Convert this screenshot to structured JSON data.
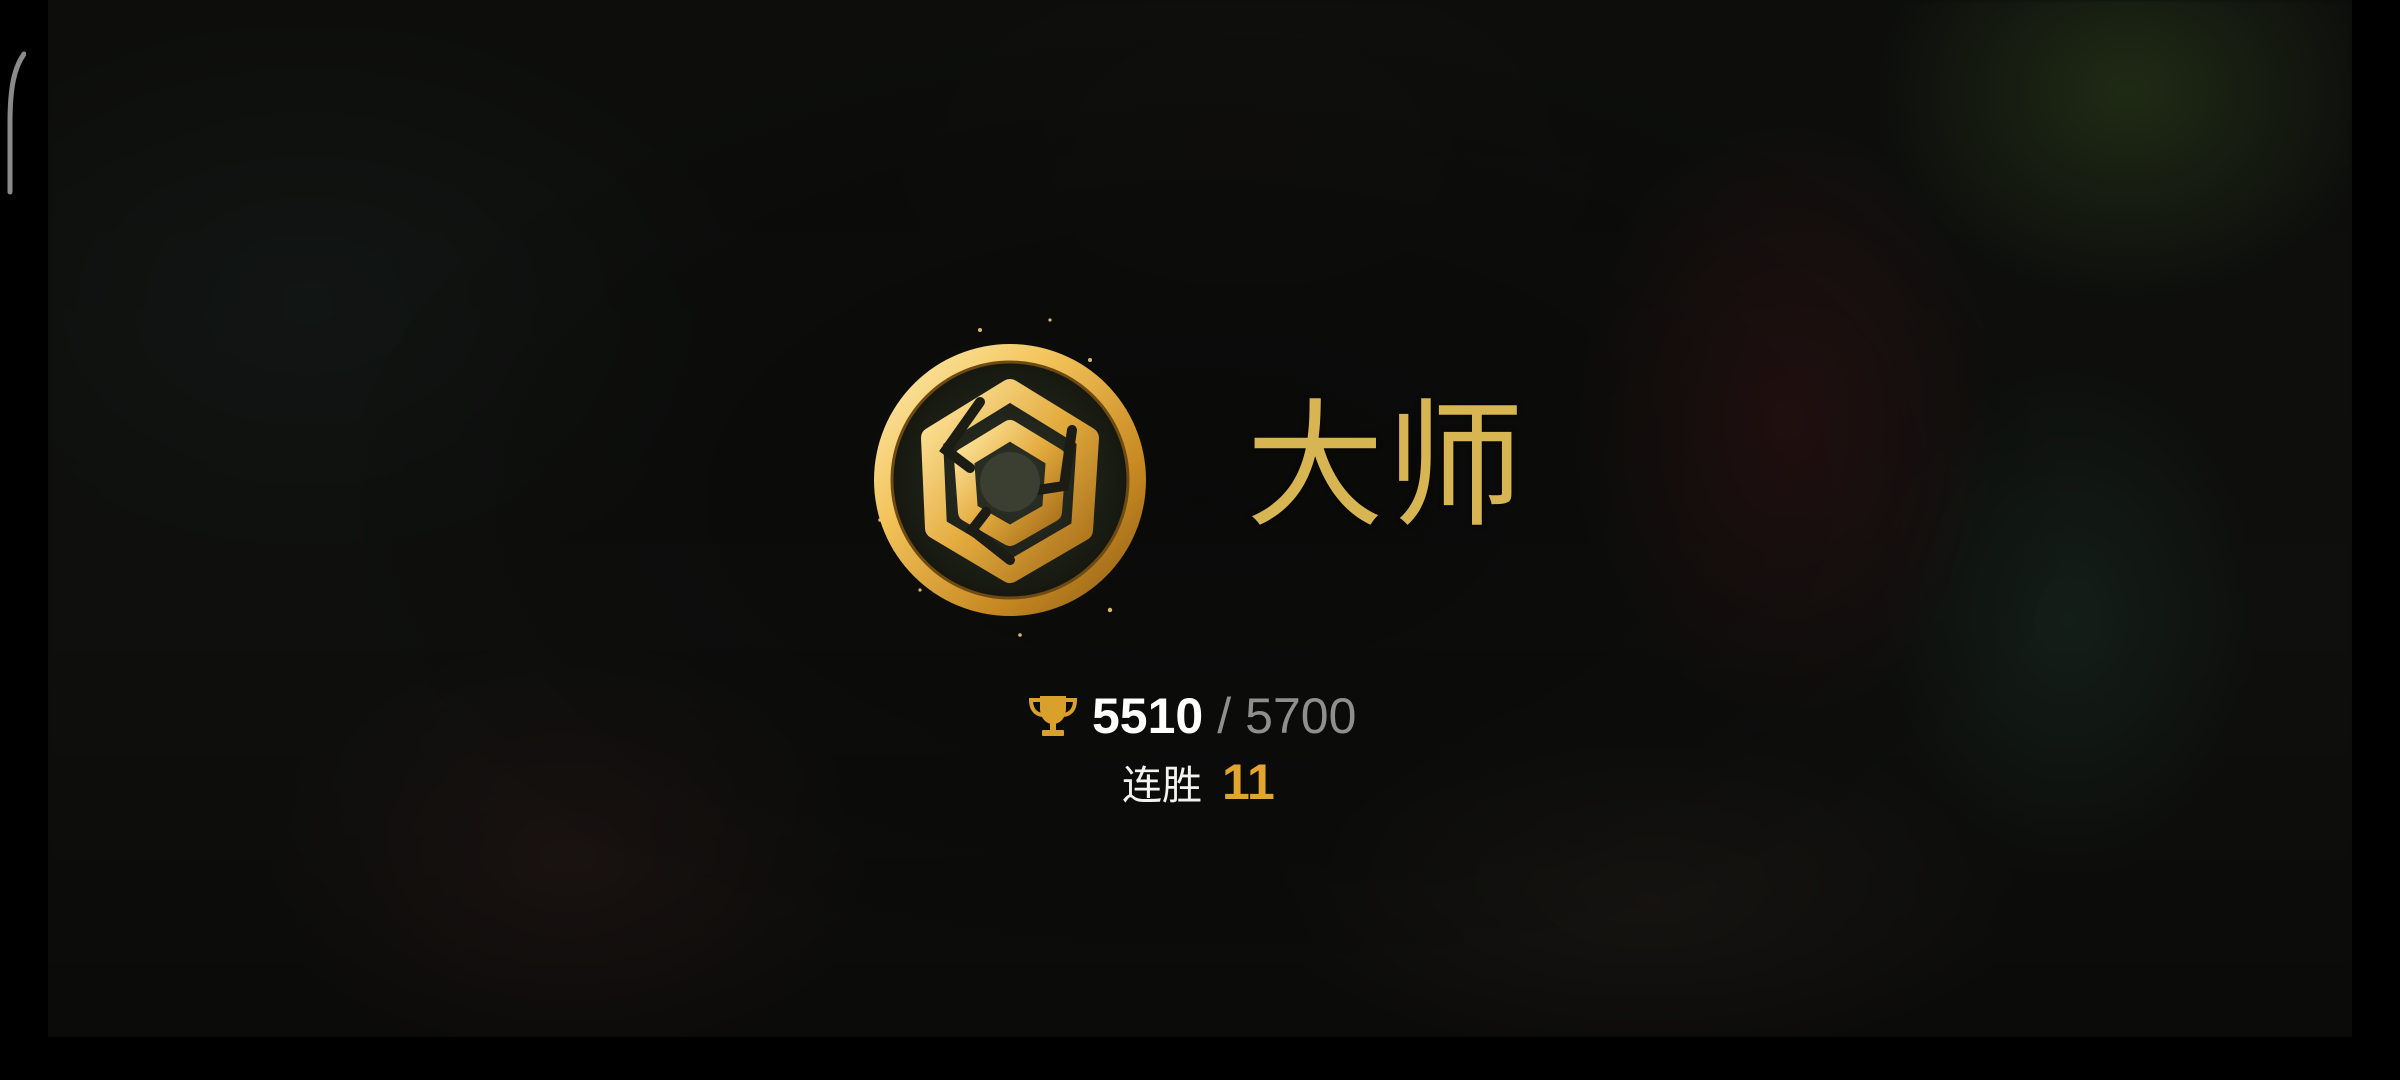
{
  "rank": {
    "name": "大师",
    "emblem_icon": "master-rank-emblem-icon",
    "accent_color": "#d8b553"
  },
  "points": {
    "icon": "trophy-icon",
    "current": "5510",
    "separator": "/",
    "max": "5700",
    "progress": 0.9667
  },
  "streak": {
    "label": "连胜",
    "value": "11",
    "value_color": "#e2a52f"
  },
  "nav": {
    "back_icon": "back-handle-icon"
  }
}
